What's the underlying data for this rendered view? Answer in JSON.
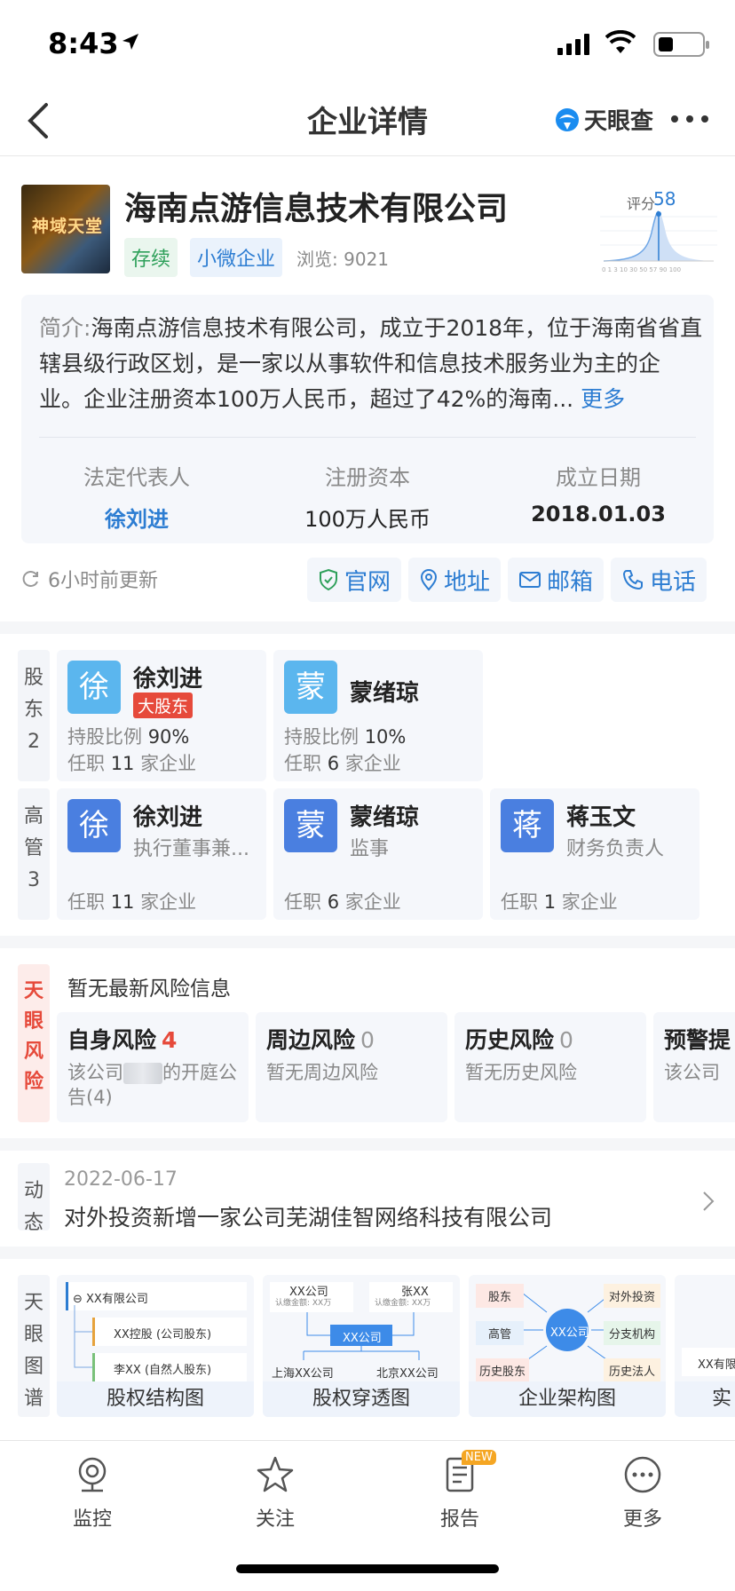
{
  "status_bar": {
    "time": "8:43"
  },
  "nav": {
    "title": "企业详情",
    "brand": "天眼查"
  },
  "company": {
    "name": "海南点游信息技术有限公司",
    "logo_text": "神域天堂",
    "status_tag": "存续",
    "type_tag": "小微企业",
    "views": "浏览: 9021",
    "score_label": "评分",
    "score_value": "58",
    "score_axis": [
      "0",
      "1",
      "3",
      "10",
      "30",
      "50",
      "57",
      "90",
      "100"
    ]
  },
  "intro": {
    "prefix": "简介:",
    "text": "海南点游信息技术有限公司，成立于2018年，位于海南省省直辖县级行政区划，是一家以从事软件和信息技术服务业为主的企业。企业注册资本100万人民币，超过了42%的海南...",
    "more": "更多",
    "legal_rep_label": "法定代表人",
    "legal_rep_value": "徐刘进",
    "capital_label": "注册资本",
    "capital_value": "100万人民币",
    "founded_label": "成立日期",
    "founded_value": "2018.01.03"
  },
  "update": {
    "text": "6小时前更新",
    "buttons": [
      "官网",
      "地址",
      "邮箱",
      "电话"
    ]
  },
  "shareholders": {
    "label": "股东2",
    "label_chars": [
      "股",
      "东",
      "2"
    ],
    "items": [
      {
        "avatar": "徐",
        "name": "徐刘进",
        "badge": "大股东",
        "ratio_label": "持股比例",
        "ratio": "90%",
        "jobs_prefix": "任职",
        "jobs": "11",
        "jobs_suffix": "家企业"
      },
      {
        "avatar": "蒙",
        "name": "蒙绪琼",
        "ratio_label": "持股比例",
        "ratio": "10%",
        "jobs_prefix": "任职",
        "jobs": "6",
        "jobs_suffix": "家企业"
      }
    ]
  },
  "executives": {
    "label_chars": [
      "高",
      "管",
      "3"
    ],
    "items": [
      {
        "avatar": "徐",
        "name": "徐刘进",
        "role": "执行董事兼...",
        "jobs_prefix": "任职",
        "jobs": "11",
        "jobs_suffix": "家企业"
      },
      {
        "avatar": "蒙",
        "name": "蒙绪琼",
        "role": "监事",
        "jobs_prefix": "任职",
        "jobs": "6",
        "jobs_suffix": "家企业"
      },
      {
        "avatar": "蒋",
        "name": "蒋玉文",
        "role": "财务负责人",
        "jobs_prefix": "任职",
        "jobs": "1",
        "jobs_suffix": "家企业"
      }
    ]
  },
  "risk": {
    "label_chars": [
      "天",
      "眼",
      "风",
      "险"
    ],
    "header": "暂无最新风险信息",
    "cards": [
      {
        "title": "自身风险",
        "count": "4",
        "desc_a": "该公司",
        "desc_b": "的开庭公告(4)"
      },
      {
        "title": "周边风险",
        "count": "0",
        "desc": "暂无周边风险"
      },
      {
        "title": "历史风险",
        "count": "0",
        "desc": "暂无历史风险"
      },
      {
        "title": "预警提",
        "desc": "该公司"
      }
    ]
  },
  "dynamic": {
    "label_chars": [
      "动",
      "态"
    ],
    "date": "2022-06-17",
    "text": "对外投资新增一家公司芜湖佳智网络科技有限公司"
  },
  "graphs": {
    "label_chars": [
      "天",
      "眼",
      "图",
      "谱"
    ],
    "cards": [
      {
        "caption": "股权结构图",
        "n1": "XX有限公司",
        "n2": "XX控股 (公司股东)",
        "n3": "李XX (自然人股东)"
      },
      {
        "caption": "股权穿透图",
        "a": "XX公司",
        "a_sub": "认缴金额: XX万",
        "b": "张XX",
        "b_sub": "认缴金额: XX万",
        "center": "XX公司",
        "c": "上海XX公司",
        "d": "北京XX公司"
      },
      {
        "caption": "企业架构图",
        "center": "XX公司",
        "l1": "股东",
        "l2": "高管",
        "l3": "历史股东",
        "r1": "对外投资",
        "r2": "分支机构",
        "r3": "历史法人"
      },
      {
        "caption": "实",
        "n1": "XX有限"
      }
    ]
  },
  "tabbar": {
    "tabs": [
      "监控",
      "关注",
      "报告",
      "更多"
    ],
    "new_badge": "NEW"
  },
  "colors": {
    "accent": "#2d7dd2",
    "danger": "#e64a3b",
    "success": "#2ea05a"
  }
}
